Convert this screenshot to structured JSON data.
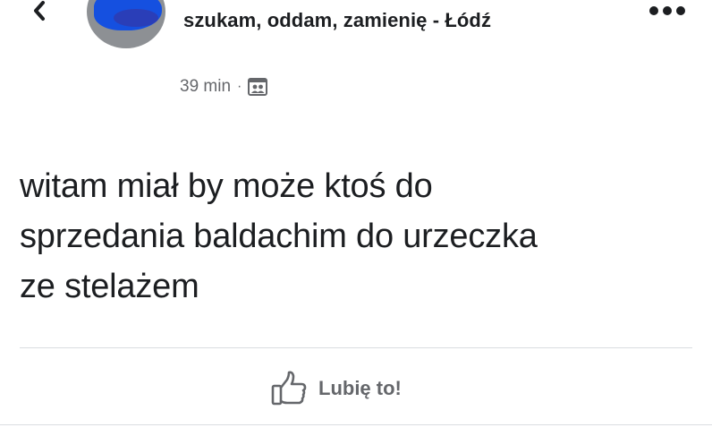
{
  "header": {
    "group_name": "szukam, oddam, zamienię - Łódź",
    "back_icon": "chevron-left-icon",
    "more_icon": "more-dots-icon"
  },
  "meta": {
    "time": "39 min",
    "separator": "·",
    "audience_icon": "group-audience-icon"
  },
  "post": {
    "text": "witam miał by może ktoś do\nsprzedania baldachim do urzeczka\nze stelażem"
  },
  "actions": {
    "like_label": "Lubię to!",
    "like_icon": "thumbs-up-icon"
  },
  "colors": {
    "text_primary": "#1c1e21",
    "text_secondary": "#65676b",
    "divider": "#dadde1",
    "avatar_blue": "#1550e0"
  }
}
